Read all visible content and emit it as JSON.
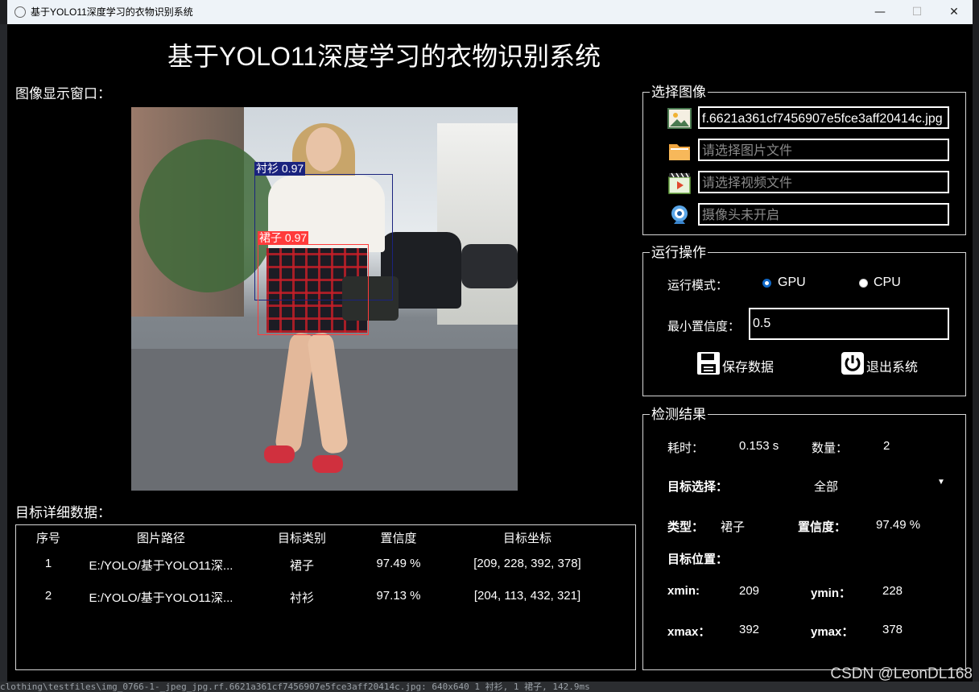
{
  "window": {
    "title": "基于YOLO11深度学习的衣物识别系统",
    "controls": [
      "—",
      "☐",
      "✕"
    ]
  },
  "header": {
    "title": "基于YOLO11深度学习的衣物识别系统"
  },
  "image_panel": {
    "label": "图像显示窗口：",
    "detections": [
      {
        "label": "衬衫 0.97",
        "color": "#1a237e"
      },
      {
        "label": "裙子 0.97",
        "color": "#ff3b3b"
      }
    ]
  },
  "select_image": {
    "title": "选择图像",
    "image_value": "f.6621a361cf7456907e5fce3aff20414c.jpg",
    "folder_placeholder": "请选择图片文件",
    "video_placeholder": "请选择视频文件",
    "camera_placeholder": "摄像头未开启"
  },
  "run_ops": {
    "title": "运行操作",
    "mode_label": "运行模式：",
    "gpu_label": "GPU",
    "cpu_label": "CPU",
    "selected_mode": "GPU",
    "conf_label": "最小置信度：",
    "conf_value": "0.5",
    "save_label": "保存数据",
    "exit_label": "退出系统"
  },
  "results": {
    "title": "检测结果",
    "time_label": "耗时：",
    "time_value": "0.153 s",
    "count_label": "数量：",
    "count_value": "2",
    "target_select_label": "目标选择：",
    "target_select_value": "全部",
    "type_label": "类型：",
    "type_value": "裙子",
    "conf_label": "置信度：",
    "conf_value": "97.49 %",
    "position_label": "目标位置：",
    "xmin_label": "xmin:",
    "xmin_value": "209",
    "ymin_label": "ymin：",
    "ymin_value": "228",
    "xmax_label": "xmax：",
    "xmax_value": "392",
    "ymax_label": "ymax：",
    "ymax_value": "378"
  },
  "table": {
    "label": "目标详细数据：",
    "headers": [
      "序号",
      "图片路径",
      "目标类别",
      "置信度",
      "目标坐标"
    ],
    "rows": [
      [
        "1",
        "E:/YOLO/基于YOLO11深...",
        "裙子",
        "97.49 %",
        "[209, 228, 392, 378]"
      ],
      [
        "2",
        "E:/YOLO/基于YOLO11深...",
        "衬衫",
        "97.13 %",
        "[204, 113, 432, 321]"
      ]
    ]
  },
  "background": {
    "console_line": "clothing\\testfiles\\img_0766-1-_jpeg_jpg.rf.6621a361cf7456907e5fce3aff20414c.jpg: 640x640 1 衬衫, 1 裙子, 142.9ms",
    "watermark": "CSDN @LeonDL168"
  },
  "colors": {
    "accent": "#0f67c6",
    "background": "#000000",
    "titlebar": "#eef3f8"
  }
}
